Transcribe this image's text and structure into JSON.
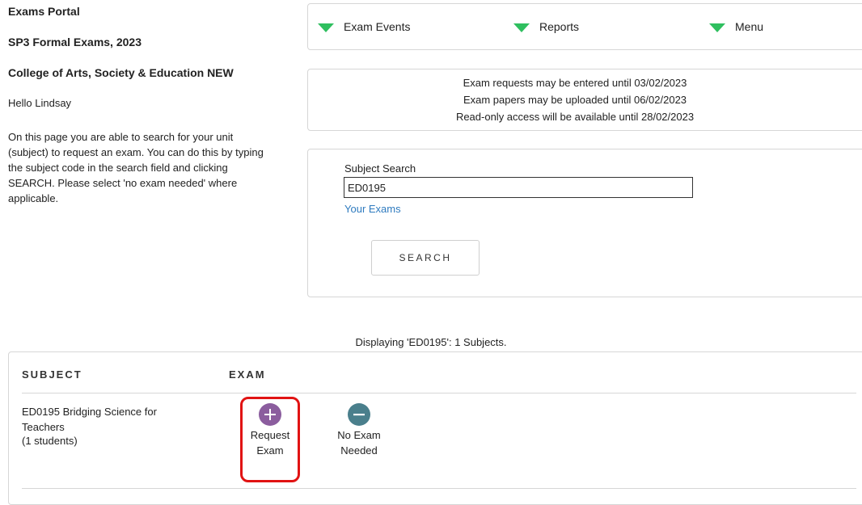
{
  "left": {
    "portal_title": "Exams Portal",
    "exam_period": "SP3 Formal Exams, 2023",
    "college": "College of Arts, Society & Education NEW",
    "greeting": "Hello Lindsay",
    "instructions": "On this page you are able to search for your unit (subject) to request an exam. You can do this by typing the subject code in the search field and clicking SEARCH. Please select 'no exam needed' where applicable."
  },
  "nav": {
    "items": [
      {
        "label": "Exam Events",
        "icon": "triangle-down-icon"
      },
      {
        "label": "Reports",
        "icon": "triangle-down-icon"
      },
      {
        "label": "Menu",
        "icon": "triangle-down-icon"
      }
    ],
    "accent_color": "#2fbf5f"
  },
  "info": {
    "lines": [
      "Exam requests may be entered until 03/02/2023",
      "Exam papers may be uploaded until 06/02/2023",
      "Read-only access will be available until 28/02/2023"
    ]
  },
  "search": {
    "label": "Subject Search",
    "value": "ED0195",
    "your_exams_link": "Your Exams",
    "button_label": "SEARCH"
  },
  "results": {
    "summary": "Displaying 'ED0195': 1 Subjects.",
    "columns": [
      "SUBJECT",
      "EXAM"
    ],
    "rows": [
      {
        "subject": "ED0195 Bridging Science for Teachers",
        "students": "(1 students)",
        "actions": [
          {
            "label": "Request Exam",
            "icon": "plus-circle-icon",
            "color": "#8b5d9e"
          },
          {
            "label": "No Exam Needed",
            "icon": "minus-circle-icon",
            "color": "#4a7f8c"
          }
        ]
      }
    ],
    "highlight_color": "#e11313"
  }
}
